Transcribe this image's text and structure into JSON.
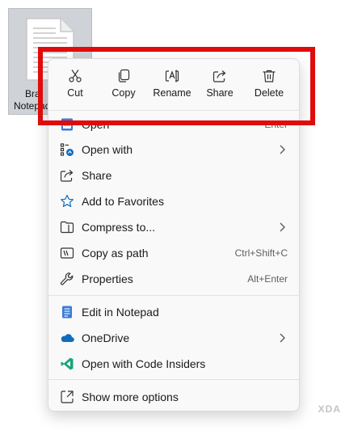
{
  "file": {
    "label_line1": "Bra",
    "label_line2": "Notepad"
  },
  "quick_actions": [
    {
      "label": "Cut",
      "icon": "scissors-icon"
    },
    {
      "label": "Copy",
      "icon": "copy-icon"
    },
    {
      "label": "Rename",
      "icon": "rename-icon"
    },
    {
      "label": "Share",
      "icon": "share-icon"
    },
    {
      "label": "Delete",
      "icon": "trash-icon"
    }
  ],
  "menu": {
    "open": {
      "label": "Open",
      "shortcut": "Enter"
    },
    "open_with": {
      "label": "Open with"
    },
    "share": {
      "label": "Share"
    },
    "favorites": {
      "label": "Add to Favorites"
    },
    "compress": {
      "label": "Compress to..."
    },
    "copy_path": {
      "label": "Copy as path",
      "shortcut": "Ctrl+Shift+C"
    },
    "properties": {
      "label": "Properties",
      "shortcut": "Alt+Enter"
    },
    "notepad": {
      "label": "Edit in Notepad"
    },
    "onedrive": {
      "label": "OneDrive"
    },
    "code": {
      "label": "Open with Code Insiders"
    },
    "more": {
      "label": "Show more options"
    }
  },
  "watermark": "XDA",
  "colors": {
    "highlight": "#e00b0b",
    "accent": "#0f6cbd"
  }
}
